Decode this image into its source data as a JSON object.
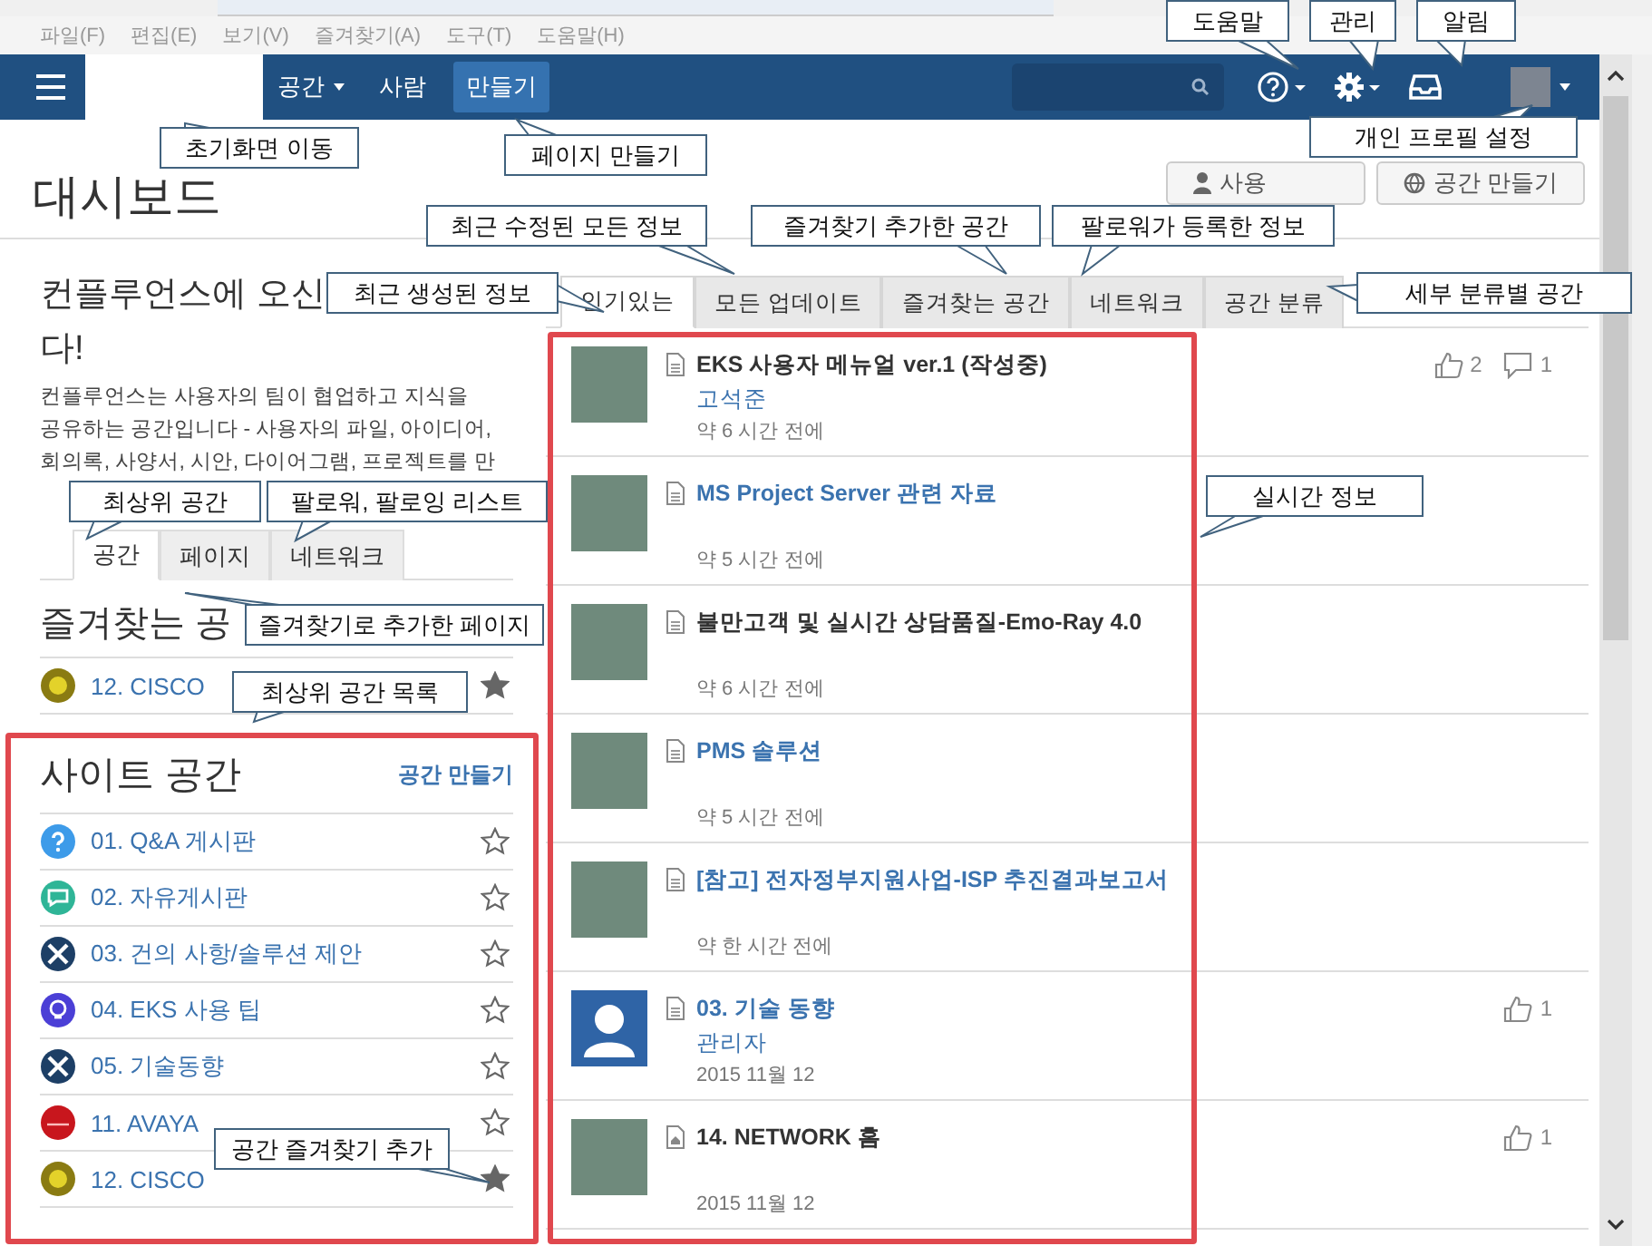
{
  "menu_bar": [
    "파일(F)",
    "편집(E)",
    "보기(V)",
    "즐겨찾기(A)",
    "도구(T)",
    "도움말(H)"
  ],
  "nav": {
    "items": [
      {
        "label": "공간",
        "dropdown": true
      },
      {
        "label": "사람",
        "dropdown": false
      }
    ],
    "create_button": "만들기"
  },
  "header": {
    "title": "대시보드",
    "buttons": [
      {
        "label": "사용"
      },
      {
        "label": "공간 만들기"
      }
    ]
  },
  "welcome": {
    "heading_lines": [
      "컨플루언스에 오신",
      "다!"
    ],
    "text": "컨플루언스는 사용자의 팀이 협업하고 지식을 공유하는 공간입니다 - 사용자의 파일, 아이디어, 회의록, 사양서, 시안, 다이어그램, 프로젝트를 만"
  },
  "sidebar_tabs": [
    {
      "label": "공간",
      "selected": true
    },
    {
      "label": "페이지",
      "selected": false
    },
    {
      "label": "네트워크",
      "selected": false
    }
  ],
  "favorites": {
    "title": "즐겨찾는 공",
    "items": [
      {
        "name": "12. CISCO",
        "kind": "cisco",
        "starred": true
      }
    ]
  },
  "site_spaces": {
    "title": "사이트 공간",
    "create_link": "공간 만들기",
    "items": [
      {
        "name": "01. Q&A 게시판",
        "kind": "question",
        "starred": false
      },
      {
        "name": "02. 자유게시판",
        "kind": "chat",
        "starred": false
      },
      {
        "name": "03. 건의 사항/솔루션 제안",
        "kind": "tools",
        "starred": false
      },
      {
        "name": "04. EKS 사용 팁",
        "kind": "bulb",
        "starred": false
      },
      {
        "name": "05. 기술동향",
        "kind": "tools",
        "starred": false
      },
      {
        "name": "11. AVAYA",
        "kind": "avaya",
        "starred": false
      },
      {
        "name": "12. CISCO",
        "kind": "cisco",
        "starred": true
      }
    ]
  },
  "feed_tabs": [
    {
      "label": "인기있는",
      "selected": true
    },
    {
      "label": "모든 업데이트",
      "selected": false
    },
    {
      "label": "즐겨찾는 공간",
      "selected": false
    },
    {
      "label": "네트워크",
      "selected": false
    },
    {
      "label": "공간 분류",
      "selected": false
    }
  ],
  "feed": [
    {
      "title": "EKS 사용자 메뉴얼 ver.1 (작성중)",
      "link": false,
      "author": "고석준",
      "time": "약 6 시간 전에",
      "likes": "2",
      "comments": "1"
    },
    {
      "title": "MS Project Server 관련 자료",
      "link": true,
      "time": "약 5 시간 전에"
    },
    {
      "title": "불만고객 및 실시간 상담품질-Emo-Ray 4.0",
      "link": false,
      "time": "약 6 시간 전에"
    },
    {
      "title": "PMS 솔루션",
      "link": true,
      "time": "약 5 시간 전에"
    },
    {
      "title": "[참고] 전자정부지원사업-ISP 추진결과보고서",
      "link": true,
      "time": "약 한 시간 전에"
    },
    {
      "title": "03. 기술 동향",
      "link": true,
      "author": "관리자",
      "time": "2015 11월 12",
      "likes": "1"
    },
    {
      "title": "14. NETWORK 홈",
      "link": false,
      "time": "2015 11월 12",
      "likes": "1"
    }
  ],
  "annotations": [
    {
      "text": "도움말"
    },
    {
      "text": "관리"
    },
    {
      "text": "알림"
    },
    {
      "text": "초기화면 이동"
    },
    {
      "text": "페이지 만들기"
    },
    {
      "text": "개인 프로필 설정"
    },
    {
      "text": "최근 수정된 모든 정보"
    },
    {
      "text": "즐겨찾기 추가한 공간"
    },
    {
      "text": "팔로워가 등록한 정보"
    },
    {
      "text": "최근 생성된 정보"
    },
    {
      "text": "세부 분류별 공간"
    },
    {
      "text": "최상위 공간"
    },
    {
      "text": "팔로워, 팔로잉 리스트"
    },
    {
      "text": "즐겨찾기로 추가한 페이지"
    },
    {
      "text": "최상위 공간 목록"
    },
    {
      "text": "실시간 정보"
    },
    {
      "text": "공간 즐겨찾기 추가"
    }
  ]
}
